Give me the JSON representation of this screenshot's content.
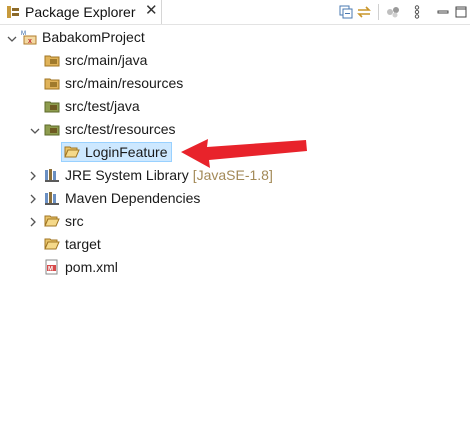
{
  "tab": {
    "title": "Package Explorer",
    "close": "✕"
  },
  "toolbar": [
    "collapse-all",
    "link-with-editor",
    "focus",
    "view-menu"
  ],
  "tree": [
    {
      "label": "BabakomProject",
      "icon": "maven-project-icon",
      "expanded": true
    },
    {
      "label": "src/main/java",
      "icon": "package-folder-icon"
    },
    {
      "label": "src/main/resources",
      "icon": "package-folder-icon"
    },
    {
      "label": "src/test/java",
      "icon": "package-folder-icon"
    },
    {
      "label": "src/test/resources",
      "icon": "package-folder-icon",
      "expanded": true
    },
    {
      "label": "LoginFeature",
      "icon": "open-folder-icon",
      "selected": true
    },
    {
      "label": "JRE System Library",
      "decoration": "[JavaSE-1.8]",
      "icon": "library-icon",
      "expanded": false
    },
    {
      "label": "Maven Dependencies",
      "icon": "library-icon",
      "expanded": false
    },
    {
      "label": "src",
      "icon": "folder-icon",
      "expanded": false
    },
    {
      "label": "target",
      "icon": "folder-icon"
    },
    {
      "label": "pom.xml",
      "icon": "maven-pom-icon"
    }
  ],
  "colors": {
    "selection": "#cde8ff",
    "arrow": "#e8232b",
    "decoration": "#a38a58"
  }
}
